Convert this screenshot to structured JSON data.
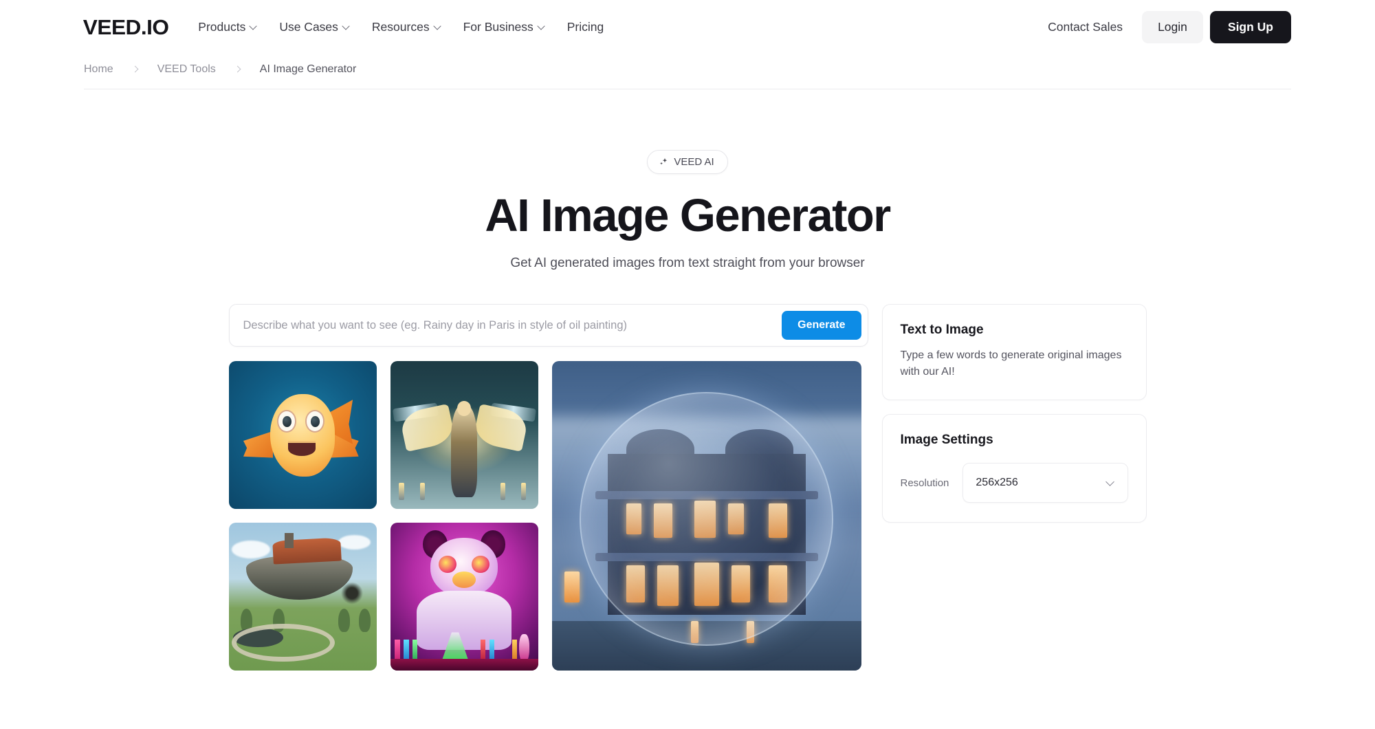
{
  "header": {
    "logo": "VEED.IO",
    "nav": [
      {
        "label": "Products",
        "has_chevron": true,
        "icon": "chevron-down-icon"
      },
      {
        "label": "Use Cases",
        "has_chevron": true,
        "icon": "chevron-down-icon"
      },
      {
        "label": "Resources",
        "has_chevron": true,
        "icon": "chevron-down-icon"
      },
      {
        "label": "For Business",
        "has_chevron": true,
        "icon": "chevron-down-icon"
      },
      {
        "label": "Pricing",
        "has_chevron": false,
        "icon": ""
      }
    ],
    "contact_sales": "Contact Sales",
    "login": "Login",
    "signup": "Sign Up"
  },
  "breadcrumb": {
    "items": [
      {
        "label": "Home"
      },
      {
        "label": "VEED Tools"
      },
      {
        "label": "AI Image Generator"
      }
    ],
    "separator_icon": "chevron-right-icon"
  },
  "hero": {
    "badge_icon": "sparkle-icon",
    "badge_label": "VEED AI",
    "title": "AI Image Generator",
    "subtitle": "Get AI generated images from text straight from your browser"
  },
  "prompt": {
    "value": "",
    "placeholder": "Describe what you want to see (eg. Rainy day in Paris in style of oil painting)",
    "generate_label": "Generate",
    "generate_color": "#0d8ce6"
  },
  "gallery": {
    "thumbnails": [
      {
        "name": "cartoon-fish",
        "alt": "Cartoon orange fish underwater"
      },
      {
        "name": "fantasy-warrior",
        "alt": "Glowing winged armored warrior"
      },
      {
        "name": "floating-house",
        "alt": "Flying house airship over green fields"
      },
      {
        "name": "neon-panda-scientist",
        "alt": "Neon panda scientist with lab flasks"
      }
    ],
    "feature_image": {
      "name": "bubble-mansion",
      "alt": "Lit mansion inside a glowing bubble at dusk"
    }
  },
  "panels": {
    "text_to_image": {
      "title": "Text to Image",
      "description": "Type a few words to generate original images with our AI!"
    },
    "image_settings": {
      "title": "Image Settings",
      "resolution_label": "Resolution",
      "resolution_value": "256x256",
      "chevron_icon": "chevron-down-icon"
    }
  }
}
